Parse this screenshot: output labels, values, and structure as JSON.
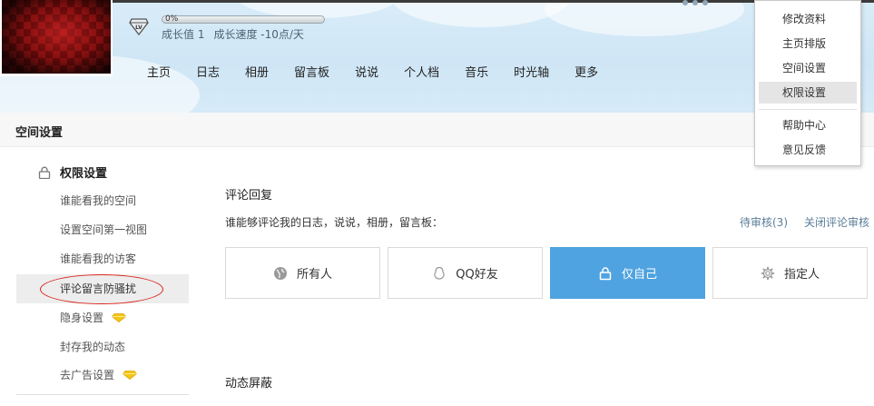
{
  "header": {
    "progress_percent": 0,
    "progress_text": "0%",
    "growth_value": "成长值 1",
    "growth_speed": "成长速度 -10点/天",
    "nav": [
      "主页",
      "日志",
      "相册",
      "留言板",
      "说说",
      "个人档",
      "音乐",
      "时光轴",
      "更多"
    ]
  },
  "dropdown": {
    "items": [
      "修改资料",
      "主页排版",
      "空间设置",
      "权限设置"
    ],
    "items2": [
      "帮助中心",
      "意见反馈"
    ],
    "active": "权限设置"
  },
  "section": {
    "title": "空间设置"
  },
  "sidebar": {
    "group_label": "权限设置",
    "items": [
      "谁能看我的空间",
      "设置空间第一视图",
      "谁能看我的访客",
      "评论留言防骚扰",
      "隐身设置",
      "封存我的动态",
      "去广告设置"
    ],
    "active": "评论留言防骚扰"
  },
  "main": {
    "title": "评论回复",
    "description": "谁能够评论我的日志，说说，相册，留言板：",
    "pending_link": "待审核(3)",
    "close_link": "关闭评论审核",
    "options": [
      "所有人",
      "QQ好友",
      "仅自己",
      "指定人"
    ],
    "selected_option": "仅自己",
    "title2": "动态屏蔽"
  },
  "colors": {
    "accent": "#4fa3e0",
    "highlight_circle": "#d9261c",
    "diamond": "#f5c518",
    "banner": "#d6eaf7"
  },
  "icons": [
    "level-badge-icon",
    "lock-icon",
    "diamond-icon",
    "globe-icon",
    "qq-penguin-icon",
    "padlock-icon",
    "gear-icon"
  ]
}
